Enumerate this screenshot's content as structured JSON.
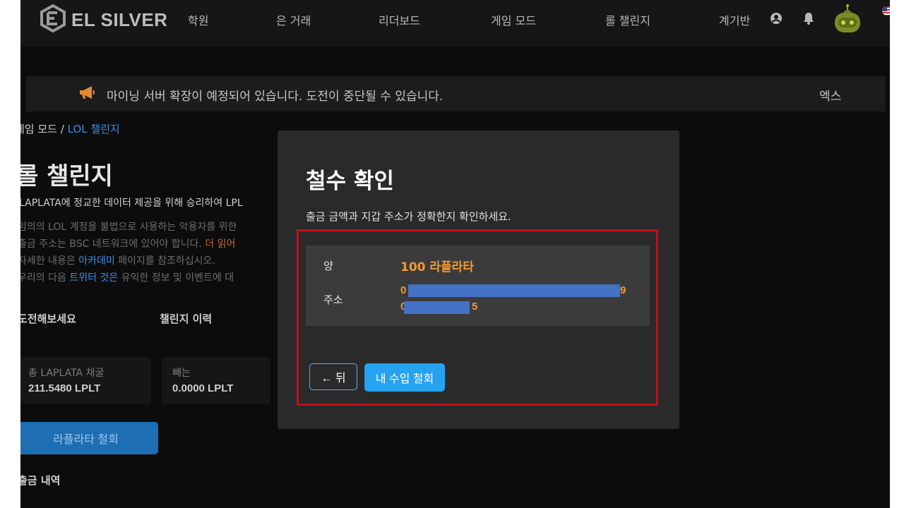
{
  "brand": {
    "name": "EL SILVER"
  },
  "nav": {
    "items": [
      "학원",
      "은 거래",
      "리더보드",
      "게임 모드",
      "롤 챌린지",
      "계기반"
    ]
  },
  "announcement": {
    "text": "마이닝 서버 확장이 예정되어 있습니다. 도전이 중단될 수 있습니다.",
    "close_label": "엑스"
  },
  "breadcrumb": {
    "parent": "게임 모드",
    "separator": " / ",
    "current": "LOL 챌린지"
  },
  "page": {
    "title": "롤 챌린지",
    "intro": "LAPLATA에 정교한 데이터 제공을 위해 승리하여 LPL",
    "para1": "임의의 LOL 계정을 불법으로 사용하는 악용자를 위한",
    "para2_a": "출금 주소는 BSC 네트워크에 있어야 합니다.",
    "para2_link": "더 읽어",
    "para3_a": "자세한 내용은",
    "para3_link": "아카데미",
    "para3_b": "페이지를 참조하십시오.",
    "para4_a": "우리의 다음",
    "para4_link": "트위터 것은",
    "para4_b": "유익한 정보 및 이벤트에 대"
  },
  "tabs": [
    "도전해보세요",
    "챌린지 이력"
  ],
  "stats": [
    {
      "label": "총 LAPLATA 채굴",
      "value": "211.5480 LPLT"
    },
    {
      "label": "빼는",
      "value": "0.0000 LPLT"
    }
  ],
  "withdraw_button": "라플라타 철회",
  "history_title": "출금 내역",
  "modal": {
    "title": "철수 확인",
    "description": "출금 금액과 지갑 주소가 정확한지 확인하세요.",
    "amount_label": "양",
    "amount_value": "100 라플라타",
    "address_label": "주소",
    "address_line1_start": "0",
    "address_line1_end": "9",
    "address_line2_start": "0",
    "address_line2_end": "5",
    "back_label": "← 뒤",
    "confirm_label": "내 수입 철회"
  },
  "colors": {
    "background": "#0c0c0c",
    "accent_orange": "#ef9a35",
    "accent_blue": "#26a2f0",
    "highlight_red": "#c0101a",
    "redaction_blue": "#4472c4"
  }
}
